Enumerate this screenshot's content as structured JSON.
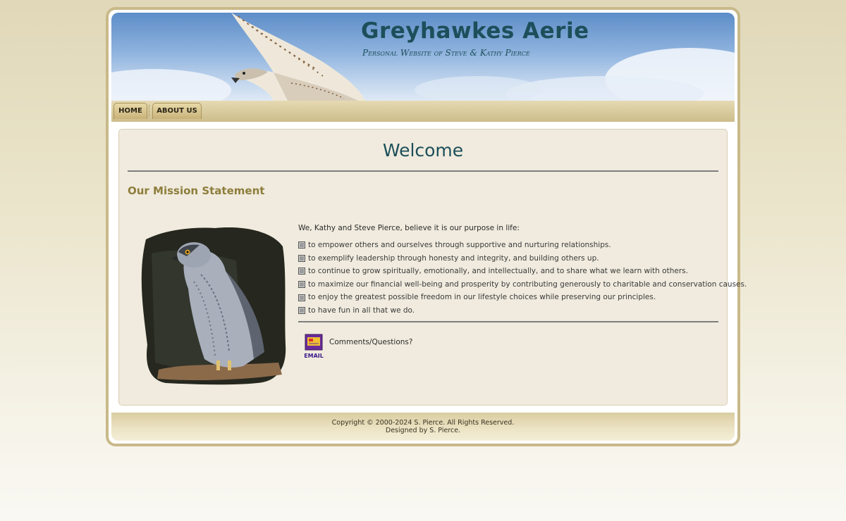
{
  "site": {
    "title": "Greyhawkes Aerie",
    "subtitle": "Personal Website of Steve & Kathy Pierce"
  },
  "nav": {
    "items": [
      {
        "label": "HOME"
      },
      {
        "label": "ABOUT US"
      }
    ]
  },
  "main": {
    "heading": "Welcome",
    "section_title": "Our Mission Statement",
    "intro": "We, Kathy and Steve Pierce, believe it is our purpose in life:",
    "goals": [
      "to empower others and ourselves through supportive and nurturing relationships.",
      "to exemplify leadership through honesty and integrity, and building others up.",
      "to continue to grow spiritually, emotionally, and intellectually, and to share what we learn with others.",
      "to maximize our financial well-being and prosperity by contributing generously to charitable and conservation causes.",
      "to enjoy the greatest possible freedom in our lifestyle choices while preserving our principles.",
      "to have fun in all that we do."
    ],
    "contact_label": "Comments/Questions?",
    "email_icon_text": "EMAIL"
  },
  "footer": {
    "copyright": "Copyright © 2000-2024 S. Pierce. All Rights Reserved.",
    "designer": "Designed by S. Pierce."
  },
  "colors": {
    "title": "#1c4f5a",
    "section_title": "#8e7d3c",
    "frame_border": "#c9b98a",
    "content_bg": "#f0ebde"
  }
}
